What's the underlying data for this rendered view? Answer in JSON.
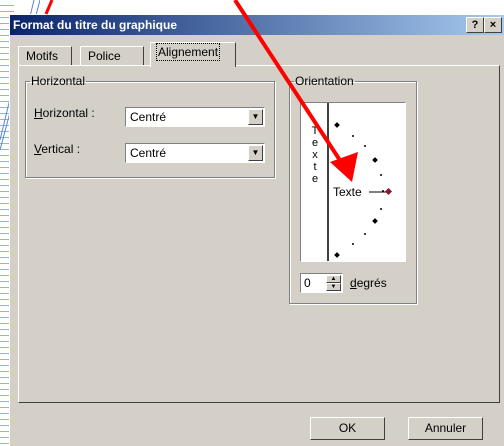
{
  "dialog": {
    "title": "Format du titre du graphique",
    "help_button": "?",
    "close_button": "×"
  },
  "tabs": [
    {
      "label": "Motifs",
      "active": false
    },
    {
      "label": "Police",
      "active": false
    },
    {
      "label": "Alignement",
      "active": true
    }
  ],
  "horizontal_group": {
    "legend": "Horizontal",
    "horizontal_label_first": "H",
    "horizontal_label_rest": "orizontal :",
    "horizontal_value": "Centré",
    "vertical_label_first": "V",
    "vertical_label_rest": "ertical :",
    "vertical_value": "Centré"
  },
  "orientation_group": {
    "legend": "Orientation",
    "vertical_text_letters": [
      "T",
      "e",
      "x",
      "t",
      "e"
    ],
    "dial_text": "Texte",
    "degrees_value": "0",
    "degrees_label_first": "d",
    "degrees_label_rest": "egrés"
  },
  "buttons": {
    "ok": "OK",
    "cancel": "Annuler"
  },
  "colors": {
    "titlebar_start": "#0a246a",
    "titlebar_end": "#a6caf0",
    "dialog_bg": "#d4d0c8",
    "annotation_arrow": "#ff0000",
    "dial_marker": "#8b1a2b"
  }
}
